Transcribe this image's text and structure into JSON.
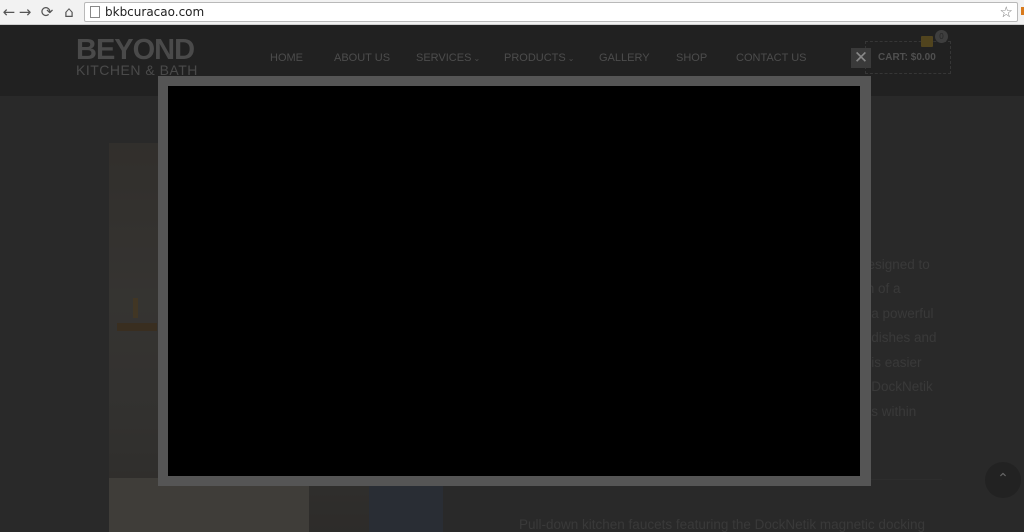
{
  "browser": {
    "url": "bkbcuracao.com",
    "back_icon": "←",
    "forward_icon": "→",
    "reload_icon": "⟳",
    "home_icon": "⌂",
    "star_icon": "☆"
  },
  "logo": {
    "top": "BEYOND",
    "bottom": "KITCHEN & BATH"
  },
  "nav": {
    "home": "HOME",
    "about": "ABOUT US",
    "services": "SERVICES",
    "products": "PRODUCTS",
    "gallery": "GALLERY",
    "shop": "SHOP",
    "contact": "CONTACT US",
    "caret": "⌄"
  },
  "cart": {
    "label": "CART:",
    "amount": "$0.00",
    "count": "0"
  },
  "lightbox": {
    "close_glyph": "✕"
  },
  "article": {
    "lines": [
      "designed to",
      "sh of a",
      "o a powerful",
      "g dishes and",
      "n is easier",
      "e DockNetik",
      "ets within"
    ],
    "bottom_line": "Pull-down kitchen faucets featuring the DockNetik magnetic docking"
  },
  "scroll_top_icon": "⌃",
  "colors": {
    "header_bg": "#1a1a1a",
    "overlay": "#555555",
    "accent": "#d87a1c"
  }
}
